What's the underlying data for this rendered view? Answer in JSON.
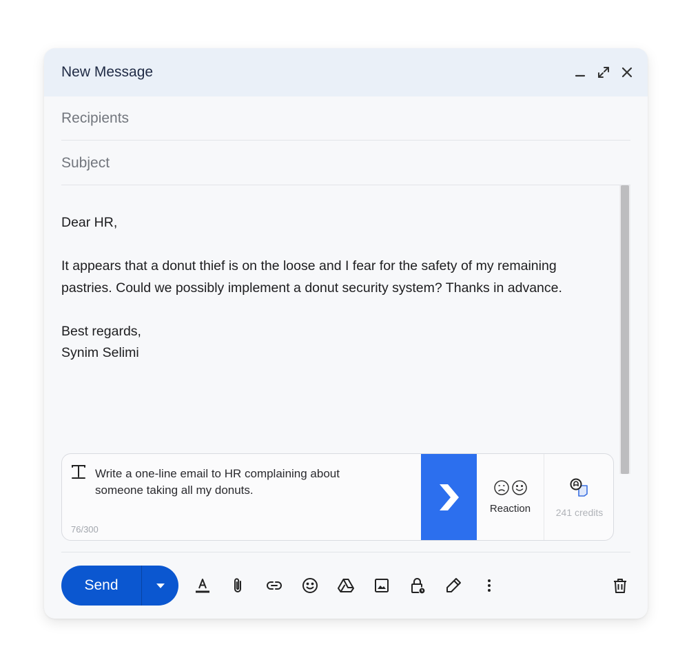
{
  "window": {
    "title": "New Message"
  },
  "fields": {
    "recipients_placeholder": "Recipients",
    "subject_placeholder": "Subject"
  },
  "body": {
    "greeting": "Dear HR,",
    "paragraph_line1": "It appears that a donut thief is on the loose and I fear for the safety of my remaining",
    "paragraph_line2": "pastries. Could we possibly implement a donut security system? Thanks in advance.",
    "closing": "Best regards,",
    "signature": "Synim Selimi"
  },
  "ai_assistant": {
    "prompt_line1": "Write a one-line email to HR complaining about",
    "prompt_line2": "someone taking all my donuts.",
    "char_count": "76/300",
    "reaction_label": "Reaction",
    "credits_label": "241 credits"
  },
  "toolbar": {
    "send_label": "Send"
  },
  "colors": {
    "titlebar_bg": "#eaf0f8",
    "send_button": "#0b57d0",
    "ai_go_button": "#2c6fee"
  },
  "icons": {
    "window": [
      "minimize-icon",
      "expand-icon",
      "close-icon"
    ],
    "toolbar": [
      "text-format-icon",
      "paperclip-icon",
      "link-icon",
      "emoji-icon",
      "drive-icon",
      "image-icon",
      "confidential-lock-icon",
      "pen-signature-icon",
      "more-vertical-icon",
      "trash-icon"
    ]
  }
}
